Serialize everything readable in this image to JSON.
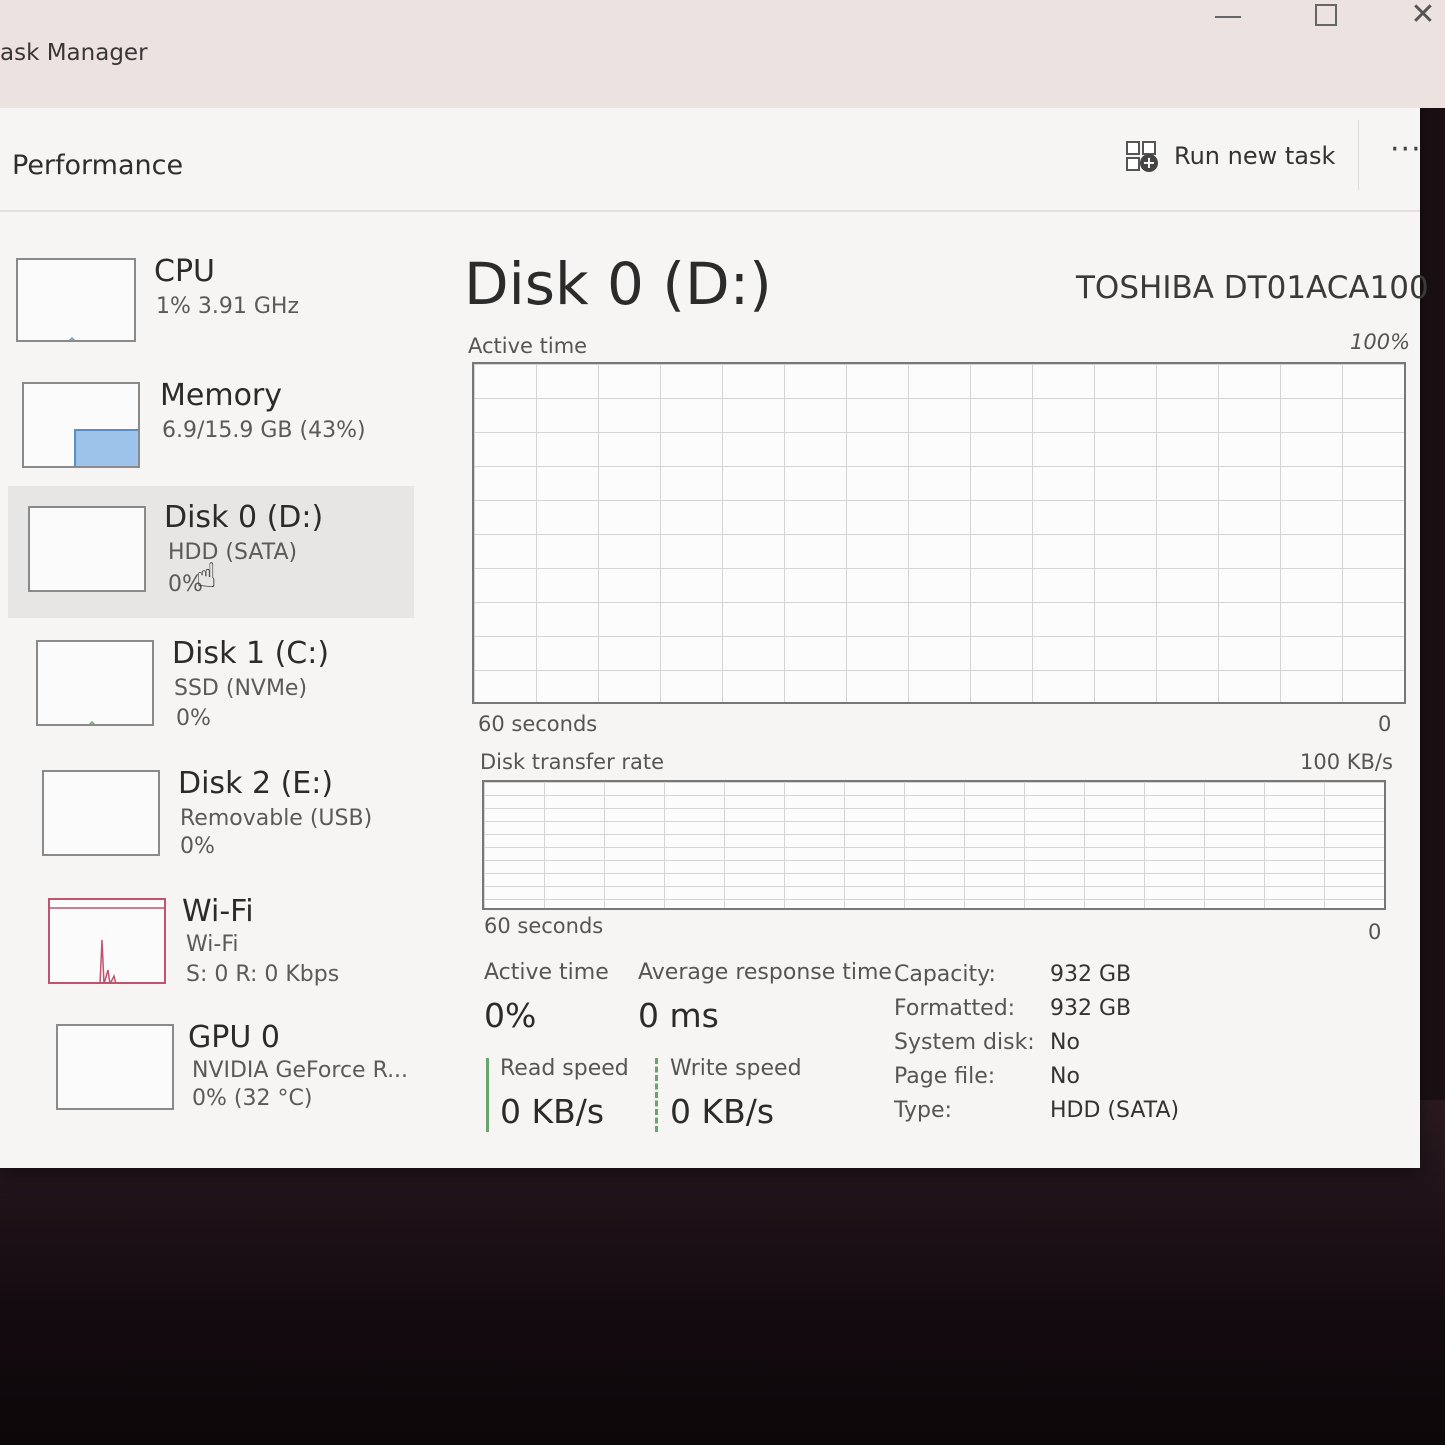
{
  "window": {
    "title": "ask Manager"
  },
  "commandbar": {
    "page_title": "Performance",
    "run_new_task_label": "Run new task",
    "more_label": "···"
  },
  "sidebar": {
    "items": [
      {
        "name": "CPU",
        "line1": "1% 3.91 GHz",
        "line2": ""
      },
      {
        "name": "Memory",
        "line1": "6.9/15.9 GB (43%)",
        "line2": ""
      },
      {
        "name": "Disk 0 (D:)",
        "line1": "HDD (SATA)",
        "line2": "0%"
      },
      {
        "name": "Disk 1 (C:)",
        "line1": "SSD (NVMe)",
        "line2": "0%"
      },
      {
        "name": "Disk 2 (E:)",
        "line1": "Removable (USB)",
        "line2": "0%"
      },
      {
        "name": "Wi-Fi",
        "line1": "Wi-Fi",
        "line2": "S: 0 R: 0 Kbps"
      },
      {
        "name": "GPU 0",
        "line1": "NVIDIA GeForce R...",
        "line2": "0% (32 °C)"
      }
    ],
    "selected_index": 2
  },
  "detail": {
    "title": "Disk 0 (D:)",
    "model": "TOSHIBA DT01ACA100",
    "active_time_graph": {
      "label": "Active time",
      "max_label": "100%",
      "time_label": "60 seconds",
      "min_label": "0"
    },
    "transfer_graph": {
      "label": "Disk transfer rate",
      "max_label": "100 KB/s",
      "time_label": "60 seconds",
      "min_label": "0"
    },
    "stats": {
      "active_time_label": "Active time",
      "active_time_value": "0%",
      "avg_response_label": "Average response time",
      "avg_response_value": "0 ms",
      "read_speed_label": "Read speed",
      "read_speed_value": "0 KB/s",
      "write_speed_label": "Write speed",
      "write_speed_value": "0 KB/s"
    },
    "properties": [
      {
        "label": "Capacity:",
        "value": "932 GB"
      },
      {
        "label": "Formatted:",
        "value": "932 GB"
      },
      {
        "label": "System disk:",
        "value": "No"
      },
      {
        "label": "Page file:",
        "value": "No"
      },
      {
        "label": "Type:",
        "value": "HDD (SATA)"
      }
    ]
  },
  "colors": {
    "memory_fill": "#9ec3ea",
    "wifi_spike": "#c0546f",
    "read_line": "#6aa56a"
  },
  "memory_usage_fraction": 0.43
}
